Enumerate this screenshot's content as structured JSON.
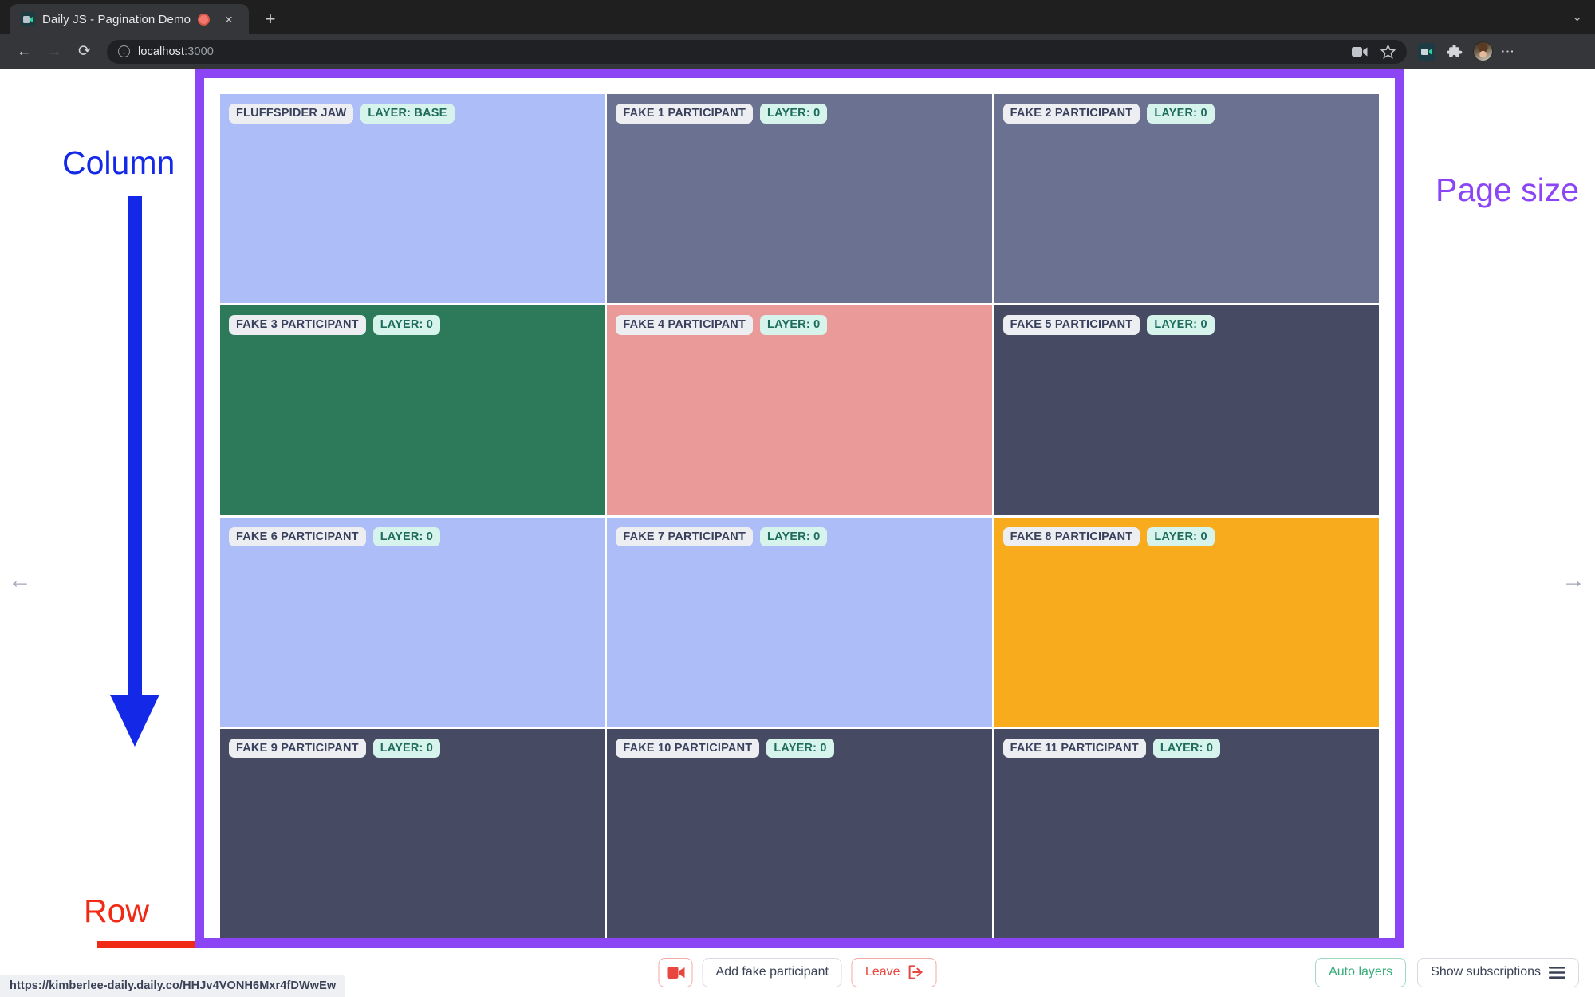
{
  "browser": {
    "tab": {
      "title": "Daily JS - Pagination Demo",
      "favicon_name": "daily-video-icon",
      "recording_indicator": "recording-dot",
      "close_label": "×"
    },
    "new_tab_label": "+",
    "tabstrip_overflow_label": "⌄",
    "nav": {
      "back_label": "←",
      "forward_label": "→",
      "reload_label": "⟳"
    },
    "omnibox": {
      "info_label": "i",
      "url_host": "localhost",
      "url_port": ":3000",
      "full_url": "localhost:3000"
    },
    "toolbar_icons": [
      {
        "name": "camera-icon"
      },
      {
        "name": "bookmark-star-icon"
      },
      {
        "name": "daily-extension-icon"
      },
      {
        "name": "extensions-puzzle-icon"
      },
      {
        "name": "profile-avatar"
      },
      {
        "name": "chrome-menu-kebab-icon"
      }
    ]
  },
  "annotations": {
    "column": {
      "label": "Column",
      "color": "#1428e8"
    },
    "row": {
      "label": "Row",
      "color": "#f02a15"
    },
    "page_size": {
      "label": "Page size",
      "color": "#8b45f5"
    }
  },
  "pagination": {
    "prev_label": "←",
    "next_label": "→"
  },
  "grid": {
    "columns": 3,
    "rows": 4,
    "tiles": [
      {
        "name": "FLUFFSPIDER JAW",
        "layer": "LAYER: BASE",
        "color": "#adbdf7"
      },
      {
        "name": "FAKE 1 PARTICIPANT",
        "layer": "LAYER: 0",
        "color": "#6b7190"
      },
      {
        "name": "FAKE 2 PARTICIPANT",
        "layer": "LAYER: 0",
        "color": "#6b7190"
      },
      {
        "name": "FAKE 3 PARTICIPANT",
        "layer": "LAYER: 0",
        "color": "#2d7a5a"
      },
      {
        "name": "FAKE 4 PARTICIPANT",
        "layer": "LAYER: 0",
        "color": "#eb9a9a"
      },
      {
        "name": "FAKE 5 PARTICIPANT",
        "layer": "LAYER: 0",
        "color": "#464b63"
      },
      {
        "name": "FAKE 6 PARTICIPANT",
        "layer": "LAYER: 0",
        "color": "#adbdf7"
      },
      {
        "name": "FAKE 7 PARTICIPANT",
        "layer": "LAYER: 0",
        "color": "#adbdf7"
      },
      {
        "name": "FAKE 8 PARTICIPANT",
        "layer": "LAYER: 0",
        "color": "#f9ab1e"
      },
      {
        "name": "FAKE 9 PARTICIPANT",
        "layer": "LAYER: 0",
        "color": "#464b63"
      },
      {
        "name": "FAKE 10 PARTICIPANT",
        "layer": "LAYER: 0",
        "color": "#464b63"
      },
      {
        "name": "FAKE 11 PARTICIPANT",
        "layer": "LAYER: 0",
        "color": "#464b63"
      }
    ]
  },
  "footer": {
    "camera_button_name": "camera-toggle-button",
    "add_fake_participant": "Add fake participant",
    "leave": "Leave",
    "auto_layers": "Auto layers",
    "show_subscriptions": "Show subscriptions"
  },
  "statusbar": {
    "link": "https://kimberlee-daily.daily.co/HHJv4VONH6Mxr4fDWwEw"
  }
}
